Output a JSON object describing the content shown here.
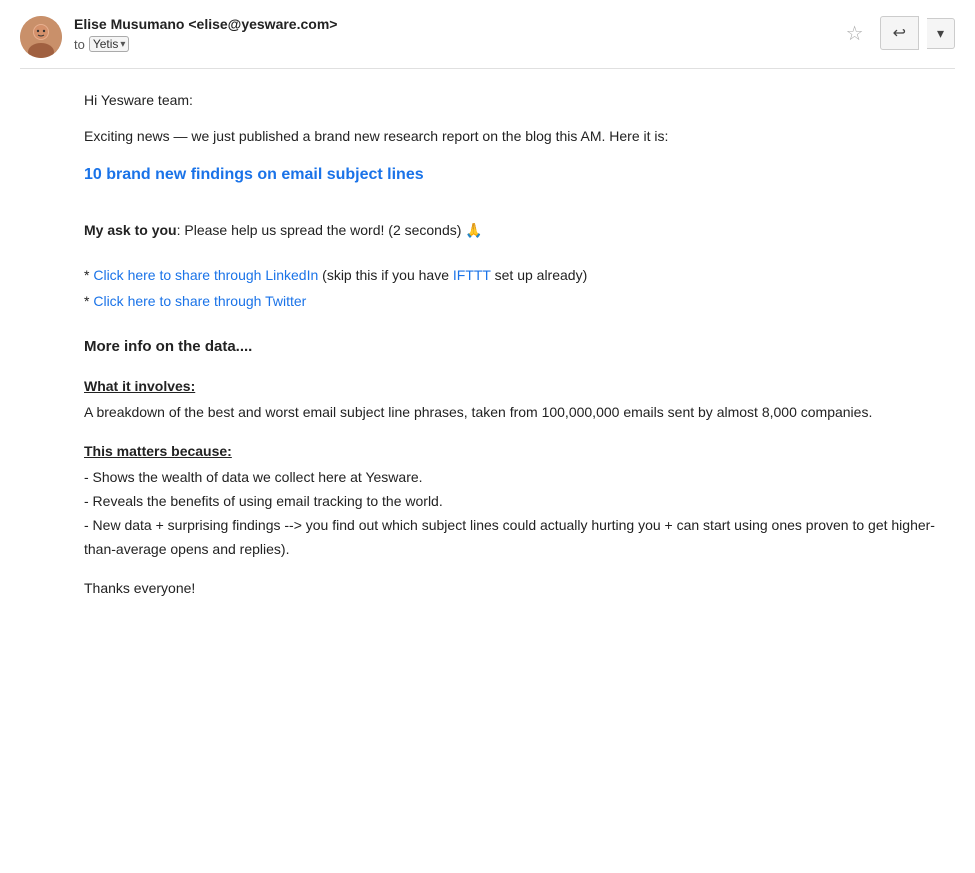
{
  "header": {
    "sender_name": "Elise Musumano",
    "sender_email": "<elise@yesware.com>",
    "to_label": "to",
    "to_group": "Yetis",
    "star_icon": "☆",
    "reply_icon": "↩",
    "more_icon": "▾"
  },
  "body": {
    "greeting": "Hi Yesware team:",
    "intro": "Exciting news — we just published a brand new research report on the blog this AM. Here it is:",
    "research_link_text": "10 brand new findings on email subject lines",
    "ask_label": "My ask to you",
    "ask_text": ": Please help us spread the word! (2 seconds) 🙏",
    "linkedin_link_text": "Click here to share through LinkedIn",
    "linkedin_suffix": " (skip this if you have ",
    "ifttt_text": "IFTTT",
    "ifttt_suffix": " set up already)",
    "twitter_prefix": "* ",
    "twitter_link_text": "Click here to share through Twitter",
    "more_info": "More info on the data....",
    "what_it_involves_label": "What it involves:",
    "what_it_involves_text": "A breakdown of the best and worst email subject line phrases, taken from 100,000,000 emails sent by almost 8,000 companies.",
    "this_matters_label": "This matters because:",
    "matters_item1": "- Shows the wealth of data we collect here at Yesware.",
    "matters_item2": "- Reveals the benefits of using email tracking to the world.",
    "matters_item3": "- New data + surprising findings --> you find out which subject lines could actually hurting you + can start using ones proven to get higher-than-average opens and replies).",
    "thanks": "Thanks everyone!"
  },
  "colors": {
    "link_blue": "#1a73e8",
    "text_dark": "#222222",
    "text_gray": "#555555"
  }
}
